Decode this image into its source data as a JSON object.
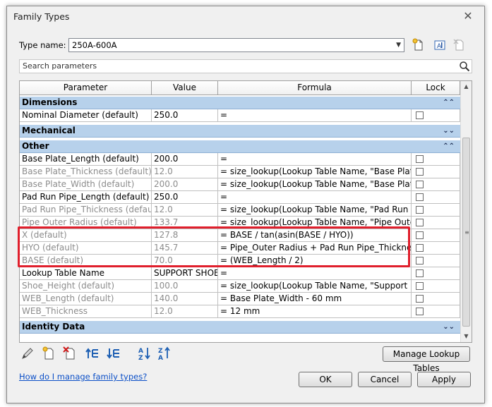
{
  "window": {
    "title": "Family Types",
    "close_glyph": "✕"
  },
  "type_row": {
    "label": "Type name:",
    "value": "250A-600A"
  },
  "search": {
    "placeholder": "Search parameters"
  },
  "grid": {
    "headers": [
      "Parameter",
      "Value",
      "Formula",
      "Lock"
    ],
    "groups": {
      "dimensions": "Dimensions",
      "mechanical": "Mechanical",
      "other": "Other",
      "identity": "Identity Data"
    },
    "rows": [
      {
        "param": "Nominal Diameter (default)",
        "value": "250.0",
        "formula": "=",
        "greyed": false
      },
      {
        "param": "Base Plate_Length (default)",
        "value": "200.0",
        "formula": "=",
        "greyed": false
      },
      {
        "param": "Base Plate_Thickness (default)",
        "value": "12.0",
        "formula": "= size_lookup(Lookup Table Name, \"Base Plate Thi",
        "greyed": true
      },
      {
        "param": "Base Plate_Width (default)",
        "value": "200.0",
        "formula": "= size_lookup(Lookup Table Name, \"Base Plate Wi",
        "greyed": true
      },
      {
        "param": "Pad Run Pipe_Length (default)",
        "value": "250.0",
        "formula": "=",
        "greyed": false
      },
      {
        "param": "Pad Run Pipe_Thickness (default)",
        "value": "12.0",
        "formula": "= size_lookup(Lookup Table Name, \"Pad Run Pipe",
        "greyed": true
      },
      {
        "param": "Pipe Outer Radius (default)",
        "value": "133.7",
        "formula": "= size_lookup(Lookup Table Name, \"Pipe Outer Di",
        "greyed": true
      },
      {
        "param": "X (default)",
        "value": "127.8",
        "formula": "= BASE / tan(asin(BASE / HYO))",
        "greyed": true
      },
      {
        "param": "HYO (default)",
        "value": "145.7",
        "formula": "= Pipe_Outer Radius + Pad Run Pipe_Thickness",
        "greyed": true
      },
      {
        "param": "BASE (default)",
        "value": "70.0",
        "formula": "= (WEB_Length / 2)",
        "greyed": true
      },
      {
        "param": "Lookup Table Name",
        "value": "SUPPORT SHOE",
        "formula": "=",
        "greyed": false
      },
      {
        "param": "Shoe_Height (default)",
        "value": "100.0",
        "formula": "= size_lookup(Lookup Table Name, \"Support Heig",
        "greyed": true
      },
      {
        "param": "WEB_Length (default)",
        "value": "140.0",
        "formula": "= Base Plate_Width - 60 mm",
        "greyed": true
      },
      {
        "param": "WEB_Thickness",
        "value": "12.0",
        "formula": "= 12 mm",
        "greyed": true
      }
    ],
    "chevron_up": "⌃",
    "chevron_down": "⌄"
  },
  "buttons": {
    "manage_lookup": "Manage Lookup Tables",
    "ok": "OK",
    "cancel": "Cancel",
    "apply": "Apply"
  },
  "help_link": "How do I manage family types?",
  "colors": {
    "group_bg": "#b7d1eb",
    "highlight": "#e01f2c",
    "link": "#0b4fc7"
  }
}
